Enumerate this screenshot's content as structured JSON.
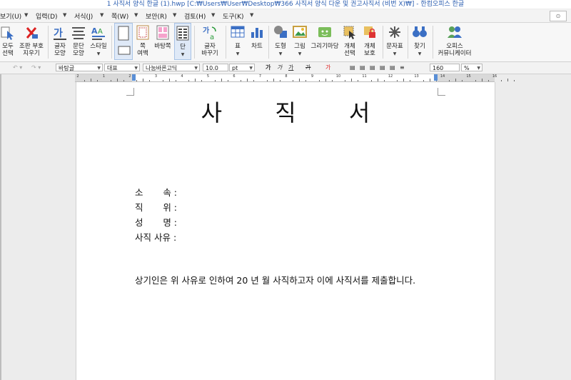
{
  "window": {
    "title": "1 사직서 양식 한글 (1).hwp [C:₩Users₩User₩Desktop₩366 사직서 양식 다운 및 권고사직서 (비번 X)₩] - 한컴오피스 한글"
  },
  "menu": {
    "items": [
      "보기(U)",
      "입력(D)",
      "서식(J)",
      "쪽(W)",
      "보안(R)",
      "검토(H)",
      "도구(K)"
    ],
    "search_label": "⊙"
  },
  "ribbon": {
    "buttons": [
      {
        "label": "모두\n선택",
        "icon": "select-all-icon"
      },
      {
        "label": "조판 부호\n지우기",
        "icon": "clear-markup-icon"
      },
      {
        "label": "글자\n모양",
        "icon": "char-shape-icon"
      },
      {
        "label": "문단\n모양",
        "icon": "para-shape-icon"
      },
      {
        "label": "스타일",
        "icon": "style-icon"
      },
      {
        "label": "",
        "icon": "page-portrait-icon"
      },
      {
        "label": "쪽\n여백",
        "icon": "page-margin-icon"
      },
      {
        "label": "바탕쪽",
        "icon": "master-page-icon"
      },
      {
        "label": "단",
        "icon": "columns-icon"
      },
      {
        "label": "글자\n바꾸기",
        "icon": "char-replace-icon"
      },
      {
        "label": "표",
        "icon": "table-icon"
      },
      {
        "label": "차트",
        "icon": "chart-icon"
      },
      {
        "label": "도형",
        "icon": "shape-icon"
      },
      {
        "label": "그림",
        "icon": "picture-icon"
      },
      {
        "label": "그리기마당",
        "icon": "clipart-icon"
      },
      {
        "label": "개체\n선택",
        "icon": "object-select-icon"
      },
      {
        "label": "개체\n보호",
        "icon": "object-protect-icon"
      },
      {
        "label": "문자표",
        "icon": "symbol-icon"
      },
      {
        "label": "찾기",
        "icon": "find-icon"
      },
      {
        "label": "오피스\n커뮤니케이터",
        "icon": "office-communicator-icon"
      }
    ]
  },
  "format": {
    "style_name": "바탕글",
    "lang": "대표",
    "font": "나눔바른고딕",
    "size": "10.0",
    "unit": "pt",
    "bold": "가",
    "italic": "가",
    "underline": "가",
    "strike": "가",
    "color": "가",
    "zoom": "160",
    "zoom_unit": "%"
  },
  "ruler": {
    "numbers": [
      "2",
      "1",
      "2",
      "3",
      "4",
      "5",
      "6",
      "7",
      "8",
      "9",
      "10",
      "11",
      "12",
      "13",
      "14",
      "15",
      "16"
    ]
  },
  "document": {
    "title": "사 직 서",
    "fields": [
      {
        "label": "소       속 :"
      },
      {
        "label": "직       위 :"
      },
      {
        "label": "성       명 :"
      },
      {
        "label": "사직 사유 :"
      }
    ],
    "body": "  상기인은 위 사유로 인하여 20  년  월 사직하고자 이에 사직서를 제출합니다."
  },
  "colors": {
    "title_text": "#2a5db0",
    "accent": "#5a8fd6",
    "ribbon_selected": "#dfe9f7"
  }
}
